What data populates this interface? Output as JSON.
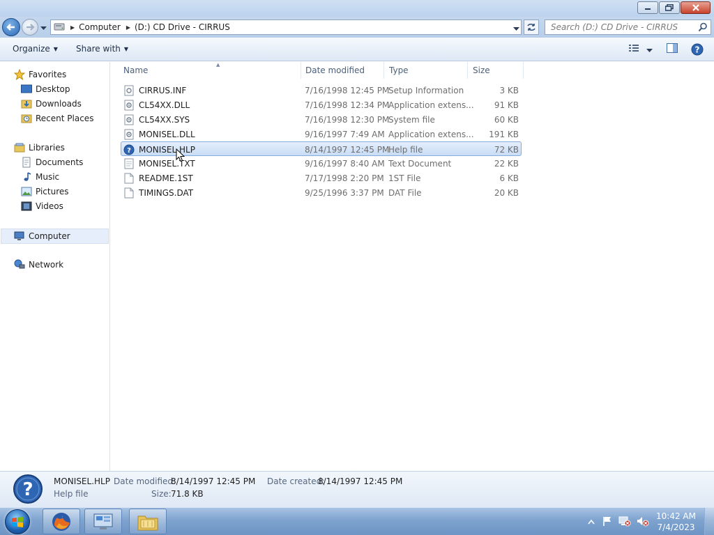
{
  "window": {
    "minimize_icon": "minimize-icon",
    "maximize_icon": "restore-icon",
    "close_icon": "close-icon"
  },
  "address": {
    "breadcrumb": [
      "Computer",
      "(D:) CD Drive - CIRRUS"
    ],
    "search_placeholder": "Search (D:) CD Drive - CIRRUS"
  },
  "toolbar": {
    "organize_label": "Organize",
    "share_label": "Share with"
  },
  "nav": {
    "favorites_label": "Favorites",
    "favorites": [
      "Desktop",
      "Downloads",
      "Recent Places"
    ],
    "libraries_label": "Libraries",
    "libraries": [
      "Documents",
      "Music",
      "Pictures",
      "Videos"
    ],
    "computer_label": "Computer",
    "network_label": "Network"
  },
  "columns": {
    "name": "Name",
    "date": "Date modified",
    "type": "Type",
    "size": "Size"
  },
  "files": [
    {
      "name": "CIRRUS.INF",
      "date": "7/16/1998 12:45 PM",
      "type": "Setup Information",
      "size": "3 KB",
      "icon": "setup-info-icon"
    },
    {
      "name": "CL54XX.DLL",
      "date": "7/16/1998 12:34 PM",
      "type": "Application extens...",
      "size": "91 KB",
      "icon": "dll-icon"
    },
    {
      "name": "CL54XX.SYS",
      "date": "7/16/1998 12:30 PM",
      "type": "System file",
      "size": "60 KB",
      "icon": "sys-file-icon"
    },
    {
      "name": "MONISEL.DLL",
      "date": "9/16/1997 7:49 AM",
      "type": "Application extens...",
      "size": "191 KB",
      "icon": "dll-icon"
    },
    {
      "name": "MONISEL.HLP",
      "date": "8/14/1997 12:45 PM",
      "type": "Help file",
      "size": "72 KB",
      "icon": "help-file-icon",
      "selected": true
    },
    {
      "name": "MONISEL.TXT",
      "date": "9/16/1997 8:40 AM",
      "type": "Text Document",
      "size": "22 KB",
      "icon": "text-file-icon"
    },
    {
      "name": "README.1ST",
      "date": "7/17/1998 2:20 PM",
      "type": "1ST File",
      "size": "6 KB",
      "icon": "generic-file-icon"
    },
    {
      "name": "TIMINGS.DAT",
      "date": "9/25/1996 3:37 PM",
      "type": "DAT File",
      "size": "20 KB",
      "icon": "generic-file-icon"
    }
  ],
  "details": {
    "name": "MONISEL.HLP",
    "type": "Help file",
    "date_modified_label": "Date modified:",
    "date_modified": "8/14/1997 12:45 PM",
    "date_created_label": "Date created:",
    "date_created": "8/14/1997 12:45 PM",
    "size_label": "Size:",
    "size": "71.8 KB"
  },
  "taskbar": {
    "apps": [
      "firefox-icon",
      "control-panel-icon",
      "file-explorer-icon"
    ],
    "time": "10:42 AM",
    "date": "7/4/2023"
  }
}
